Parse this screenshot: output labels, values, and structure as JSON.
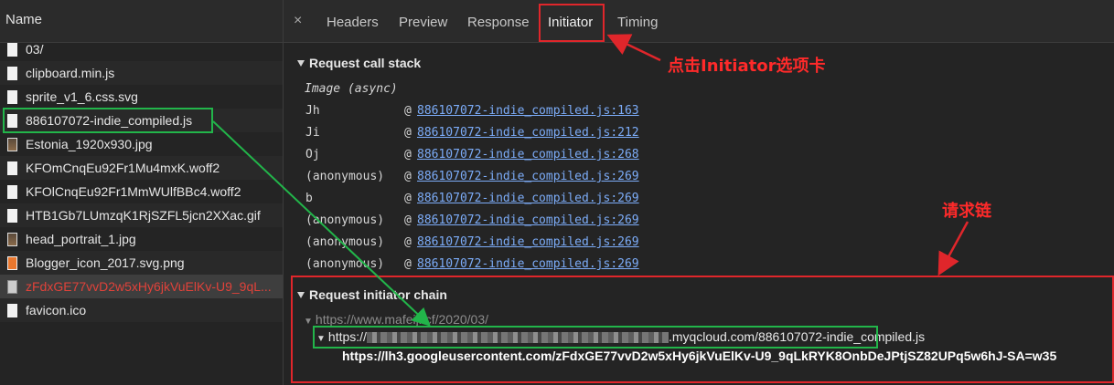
{
  "left_panel": {
    "header": "Name",
    "files": [
      {
        "name": "03/",
        "icon": "document-icon"
      },
      {
        "name": "clipboard.min.js",
        "icon": "document-icon"
      },
      {
        "name": "sprite_v1_6.css.svg",
        "icon": "document-icon"
      },
      {
        "name": "886107072-indie_compiled.js",
        "icon": "document-icon"
      },
      {
        "name": "Estonia_1920x930.jpg",
        "icon": "image-icon"
      },
      {
        "name": "KFOmCnqEu92Fr1Mu4mxK.woff2",
        "icon": "document-icon"
      },
      {
        "name": "KFOlCnqEu92Fr1MmWUlfBBc4.woff2",
        "icon": "document-icon"
      },
      {
        "name": "HTB1Gb7LUmzqK1RjSZFL5jcn2XXac.gif",
        "icon": "document-icon"
      },
      {
        "name": "head_portrait_1.jpg",
        "icon": "image-icon"
      },
      {
        "name": "Blogger_icon_2017.svg.png",
        "icon": "png-icon"
      },
      {
        "name": "zFdxGE77vvD2w5xHy6jkVuElKv-U9_9qL...",
        "icon": "broken-image-icon",
        "error": true
      },
      {
        "name": "favicon.ico",
        "icon": "document-icon"
      }
    ]
  },
  "tabs": {
    "close": "×",
    "items": [
      "Headers",
      "Preview",
      "Response",
      "Initiator",
      "Timing"
    ],
    "active": "Initiator"
  },
  "call_stack": {
    "title": "Request call stack",
    "async_label": "Image (async)",
    "frames": [
      {
        "fn": "Jh",
        "link": "886107072-indie_compiled.js:163"
      },
      {
        "fn": "Ji",
        "link": "886107072-indie_compiled.js:212"
      },
      {
        "fn": "Oj",
        "link": "886107072-indie_compiled.js:268"
      },
      {
        "fn": "(anonymous)",
        "link": "886107072-indie_compiled.js:269"
      },
      {
        "fn": "b",
        "link": "886107072-indie_compiled.js:269"
      },
      {
        "fn": "(anonymous)",
        "link": "886107072-indie_compiled.js:269"
      },
      {
        "fn": "(anonymous)",
        "link": "886107072-indie_compiled.js:269"
      },
      {
        "fn": "(anonymous)",
        "link": "886107072-indie_compiled.js:269"
      }
    ],
    "at_symbol": "@"
  },
  "initiator_chain": {
    "title": "Request initiator chain",
    "level1": "https://www.mafeiji.cf/2020/03/",
    "level2_prefix": "https://",
    "level2_suffix": ".myqcloud.com/886107072-indie_compiled.js",
    "level3": "https://lh3.googleusercontent.com/zFdxGE77vvD2w5xHy6jkVuElKv-U9_9qLkRYK8OnbDeJPtjSZ82UPq5w6hJ-SA=w35"
  },
  "annotations": {
    "click_initiator": "点击Initiator选项卡",
    "request_chain": "请求链"
  },
  "colors": {
    "annotation_red": "#e0262b",
    "annotation_green": "#22b54a",
    "link_blue": "#7cacf8",
    "error_red": "#e0423a"
  }
}
